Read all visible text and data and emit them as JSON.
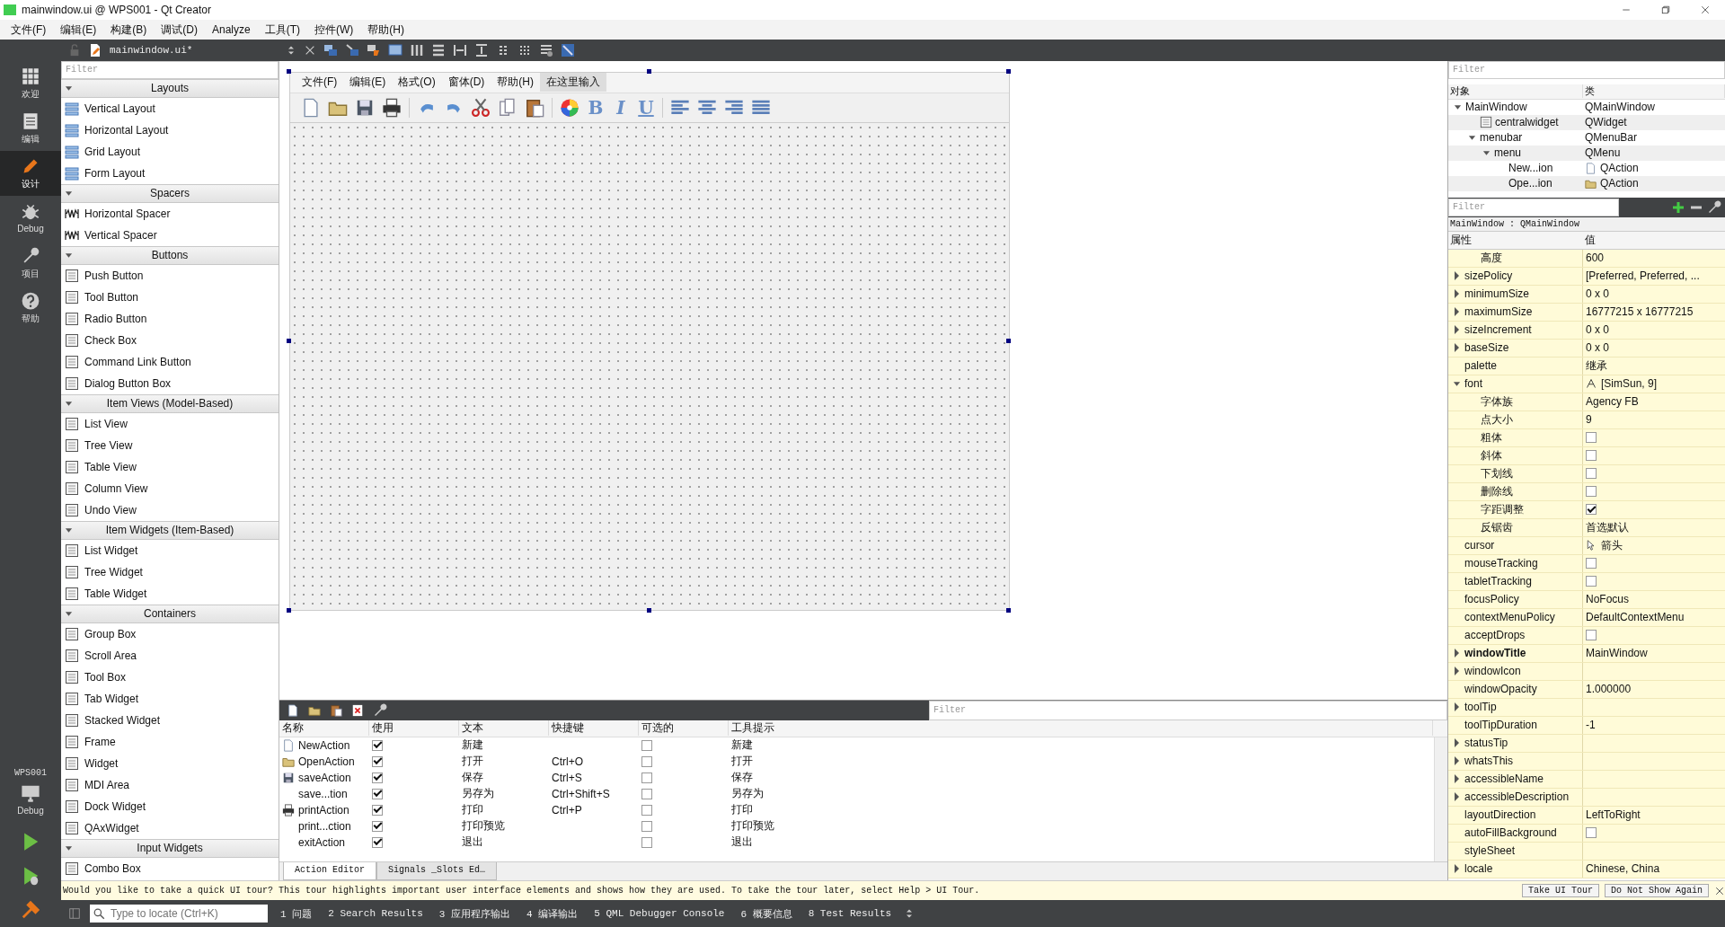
{
  "window": {
    "title": "mainwindow.ui @ WPS001 - Qt Creator"
  },
  "menu": [
    "文件(F)",
    "编辑(E)",
    "构建(B)",
    "调试(D)",
    "Analyze",
    "工具(T)",
    "控件(W)",
    "帮助(H)"
  ],
  "mode_bar": {
    "modes": [
      {
        "label": "欢迎",
        "selected": false
      },
      {
        "label": "编辑",
        "selected": false
      },
      {
        "label": "设计",
        "selected": true
      },
      {
        "label": "Debug",
        "selected": false
      },
      {
        "label": "项目",
        "selected": false
      },
      {
        "label": "帮助",
        "selected": false
      }
    ],
    "kit": {
      "project": "WPS001",
      "mode": "Debug"
    }
  },
  "editor_toolbar": {
    "file": "mainwindow.ui*"
  },
  "widget_box": {
    "filter_placeholder": "Filter",
    "categories": [
      {
        "name": "Layouts",
        "expanded": true,
        "items": [
          "Vertical Layout",
          "Horizontal Layout",
          "Grid Layout",
          "Form Layout"
        ]
      },
      {
        "name": "Spacers",
        "expanded": true,
        "items": [
          "Horizontal Spacer",
          "Vertical Spacer"
        ]
      },
      {
        "name": "Buttons",
        "expanded": true,
        "items": [
          "Push Button",
          "Tool Button",
          "Radio Button",
          "Check Box",
          "Command Link Button",
          "Dialog Button Box"
        ]
      },
      {
        "name": "Item Views (Model-Based)",
        "expanded": true,
        "items": [
          "List View",
          "Tree View",
          "Table View",
          "Column View",
          "Undo View"
        ]
      },
      {
        "name": "Item Widgets (Item-Based)",
        "expanded": true,
        "items": [
          "List Widget",
          "Tree Widget",
          "Table Widget"
        ]
      },
      {
        "name": "Containers",
        "expanded": true,
        "items": [
          "Group Box",
          "Scroll Area",
          "Tool Box",
          "Tab Widget",
          "Stacked Widget",
          "Frame",
          "Widget",
          "MDI Area",
          "Dock Widget",
          "QAxWidget"
        ]
      },
      {
        "name": "Input Widgets",
        "expanded": true,
        "items": [
          "Combo Box"
        ]
      }
    ]
  },
  "form": {
    "menus": [
      {
        "label": "文件(F)",
        "kind": "menu"
      },
      {
        "label": "编辑(E)",
        "kind": "menu"
      },
      {
        "label": "格式(O)",
        "kind": "menu"
      },
      {
        "label": "窗体(D)",
        "kind": "menu"
      },
      {
        "label": "帮助(H)",
        "kind": "menu"
      },
      {
        "label": "在这里输入",
        "kind": "type-here"
      }
    ],
    "format_buttons": [
      "B",
      "I",
      "U"
    ]
  },
  "action_editor": {
    "filter_placeholder": "Filter",
    "columns": [
      "名称",
      "使用",
      "文本",
      "快捷键",
      "可选的",
      "工具提示"
    ],
    "rows": [
      {
        "name": "NewAction",
        "used": true,
        "text": "新建",
        "shortcut": "",
        "checkable": false,
        "tooltip": "新建"
      },
      {
        "name": "OpenAction",
        "used": true,
        "text": "打开",
        "shortcut": "Ctrl+O",
        "checkable": false,
        "tooltip": "打开"
      },
      {
        "name": "saveAction",
        "used": true,
        "text": "保存",
        "shortcut": "Ctrl+S",
        "checkable": false,
        "tooltip": "保存"
      },
      {
        "name": "save...tion",
        "used": true,
        "text": "另存为",
        "shortcut": "Ctrl+Shift+S",
        "checkable": false,
        "tooltip": "另存为"
      },
      {
        "name": "printAction",
        "used": true,
        "text": "打印",
        "shortcut": "Ctrl+P",
        "checkable": false,
        "tooltip": "打印"
      },
      {
        "name": "print...ction",
        "used": true,
        "text": "打印预览",
        "shortcut": "",
        "checkable": false,
        "tooltip": "打印预览"
      },
      {
        "name": "exitAction",
        "used": true,
        "text": "退出",
        "shortcut": "",
        "checkable": false,
        "tooltip": "退出"
      }
    ],
    "tabs": [
      {
        "label": "Action Editor",
        "selected": true
      },
      {
        "label": "Signals _Slots Ed…",
        "selected": false
      }
    ]
  },
  "object_inspector": {
    "filter_placeholder": "Filter",
    "columns": [
      "对象",
      "类"
    ],
    "tree": [
      {
        "name": "MainWindow",
        "class": "QMainWindow",
        "expanded": true,
        "children": [
          {
            "name": "centralwidget",
            "class": "QWidget"
          },
          {
            "name": "menubar",
            "class": "QMenuBar",
            "expanded": true,
            "children": [
              {
                "name": "menu",
                "class": "QMenu",
                "expanded": true,
                "children": [
                  {
                    "name": "New...ion",
                    "class": "QAction"
                  },
                  {
                    "name": "Ope...ion",
                    "class": "QAction"
                  }
                ]
              }
            ]
          }
        ]
      }
    ]
  },
  "property_editor": {
    "filter_placeholder": "Filter",
    "object": "MainWindow : QMainWindow",
    "columns": [
      "属性",
      "值"
    ],
    "rows": [
      {
        "children": [
          {
            "name": "高度",
            "kind": "text",
            "value": "600"
          }
        ]
      },
      {
        "name": "sizePolicy",
        "kind": "text",
        "value": "[Preferred, Preferred, ...",
        "expanded": false
      },
      {
        "name": "minimumSize",
        "kind": "text",
        "value": "0 x 0",
        "expanded": false
      },
      {
        "name": "maximumSize",
        "kind": "text",
        "value": "16777215 x 16777215",
        "expanded": false
      },
      {
        "name": "sizeIncrement",
        "kind": "text",
        "value": "0 x 0",
        "expanded": false
      },
      {
        "name": "baseSize",
        "kind": "text",
        "value": "0 x 0",
        "expanded": false
      },
      {
        "name": "palette",
        "kind": "text",
        "value": "继承"
      },
      {
        "name": "font",
        "kind": "font",
        "value": "[SimSun, 9]",
        "expanded": true,
        "children": [
          {
            "name": "字体族",
            "kind": "text",
            "value": "Agency FB"
          },
          {
            "name": "点大小",
            "kind": "text",
            "value": "9"
          },
          {
            "name": "粗体",
            "kind": "check",
            "checked": false
          },
          {
            "name": "斜体",
            "kind": "check",
            "checked": false
          },
          {
            "name": "下划线",
            "kind": "check",
            "checked": false
          },
          {
            "name": "删除线",
            "kind": "check",
            "checked": false
          },
          {
            "name": "字距调整",
            "kind": "check",
            "checked": true
          },
          {
            "name": "反锯齿",
            "kind": "text",
            "value": "首选默认"
          }
        ]
      },
      {
        "name": "cursor",
        "kind": "cursor",
        "value": "箭头"
      },
      {
        "name": "mouseTracking",
        "kind": "check",
        "checked": false
      },
      {
        "name": "tabletTracking",
        "kind": "check",
        "checked": false
      },
      {
        "name": "focusPolicy",
        "kind": "text",
        "value": "NoFocus"
      },
      {
        "name": "contextMenuPolicy",
        "kind": "text",
        "value": "DefaultContextMenu"
      },
      {
        "name": "acceptDrops",
        "kind": "check",
        "checked": false
      },
      {
        "name": "windowTitle",
        "kind": "text",
        "value": "MainWindow",
        "expanded": false,
        "modified": true
      },
      {
        "name": "windowIcon",
        "kind": "text",
        "expanded": false
      },
      {
        "name": "windowOpacity",
        "kind": "text",
        "value": "1.000000"
      },
      {
        "name": "toolTip",
        "kind": "text",
        "expanded": false
      },
      {
        "name": "toolTipDuration",
        "kind": "text",
        "value": "-1"
      },
      {
        "name": "statusTip",
        "kind": "text",
        "expanded": false
      },
      {
        "name": "whatsThis",
        "kind": "text",
        "expanded": false
      },
      {
        "name": "accessibleName",
        "kind": "text",
        "expanded": false
      },
      {
        "name": "accessibleDescription",
        "kind": "text",
        "expanded": false
      },
      {
        "name": "layoutDirection",
        "kind": "text",
        "value": "LeftToRight"
      },
      {
        "name": "autoFillBackground",
        "kind": "check",
        "checked": false
      },
      {
        "name": "styleSheet",
        "kind": "text"
      },
      {
        "name": "locale",
        "kind": "text",
        "value": "Chinese, China",
        "expanded": false
      }
    ]
  },
  "tour_bar": {
    "message": "Would you like to take a quick UI tour? This tour highlights important user interface elements and shows how they are used. To take the tour later, select Help > UI Tour.",
    "buttons": [
      "Take UI Tour",
      "Do Not Show Again"
    ]
  },
  "status_bar": {
    "locate_placeholder": "Type to locate (Ctrl+K)",
    "panes": [
      "1 问题",
      "2 Search Results",
      "3 应用程序输出",
      "4 编译输出",
      "5 QML Debugger Console",
      "6 概要信息",
      "8 Test Results"
    ]
  }
}
